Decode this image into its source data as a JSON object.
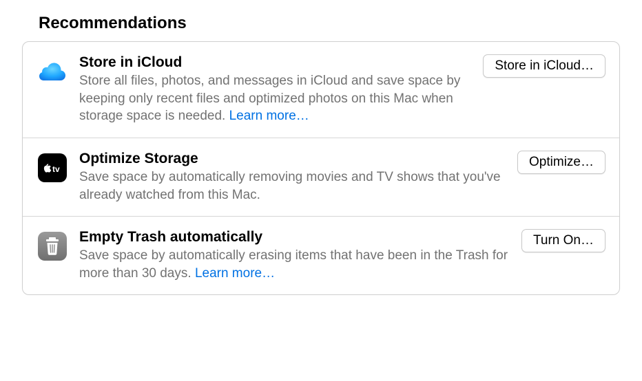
{
  "section": {
    "title": "Recommendations"
  },
  "items": [
    {
      "icon": "icloud-icon",
      "title": "Store in iCloud",
      "description": "Store all files, photos, and messages in iCloud and save space by keeping only recent files and optimized photos on this Mac when storage space is needed.",
      "learn_more": "Learn more…",
      "has_learn_more": true,
      "button_label": "Store in iCloud…"
    },
    {
      "icon": "appletv-icon",
      "title": "Optimize Storage",
      "description": "Save space by automatically removing movies and TV shows that you've already watched from this Mac.",
      "learn_more": "",
      "has_learn_more": false,
      "button_label": "Optimize…"
    },
    {
      "icon": "trash-icon",
      "title": "Empty Trash automatically",
      "description": "Save space by automatically erasing items that have been in the Trash for more than 30 days.",
      "learn_more": "Learn more…",
      "has_learn_more": true,
      "button_label": "Turn On…"
    }
  ]
}
